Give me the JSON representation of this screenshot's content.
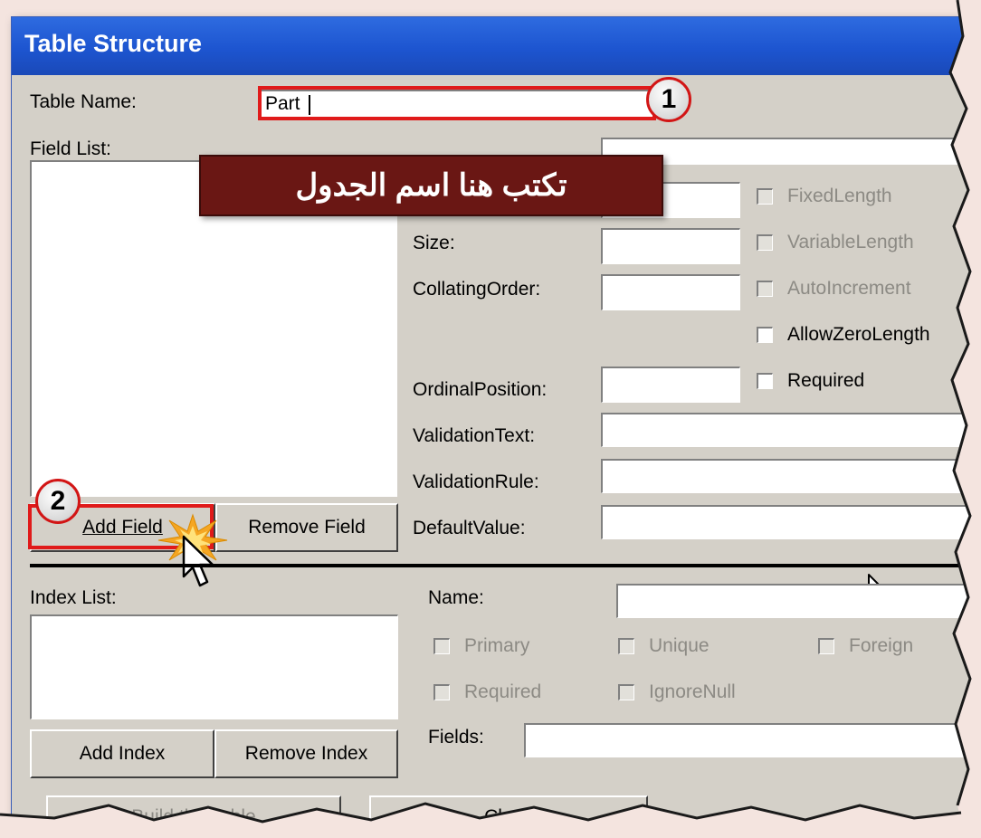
{
  "window": {
    "title": "Table Structure"
  },
  "table_name": {
    "label": "Table Name:",
    "value": "Part"
  },
  "field_list": {
    "label": "Field List:"
  },
  "annotation": {
    "banner_text": "تكتب هنا اسم الجدول",
    "step1": "1",
    "step2": "2"
  },
  "properties": {
    "size_label": "Size:",
    "collating_label": "CollatingOrder:",
    "ordinal_label": "OrdinalPosition:",
    "validation_text_label": "ValidationText:",
    "validation_rule_label": "ValidationRule:",
    "default_value_label": "DefaultValue:"
  },
  "checkboxes": {
    "fixed_length": "FixedLength",
    "variable_length": "VariableLength",
    "auto_increment": "AutoIncrement",
    "allow_zero_length": "AllowZeroLength",
    "required": "Required"
  },
  "field_buttons": {
    "add": "Add Field",
    "remove": "Remove Field"
  },
  "index": {
    "list_label": "Index List:",
    "name_label": "Name:",
    "primary": "Primary",
    "unique": "Unique",
    "foreign": "Foreign",
    "required": "Required",
    "ignore_null": "IgnoreNull",
    "fields_label": "Fields:",
    "add_button": "Add Index",
    "remove_button": "Remove Index"
  },
  "bottom_buttons": {
    "build": "Build the Table",
    "close": "Close"
  },
  "colors": {
    "accent_red": "#e01a1a",
    "title_blue": "#1d55d0",
    "banner": "#6a1714"
  }
}
